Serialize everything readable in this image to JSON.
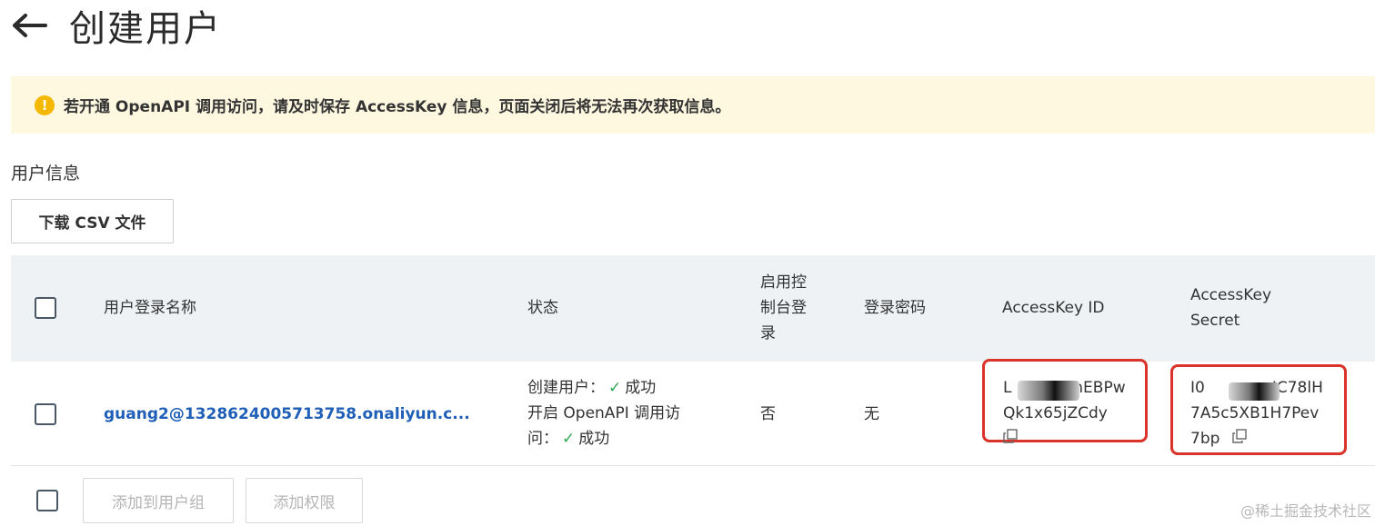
{
  "header": {
    "title": "创建用户",
    "back_icon": "arrow-left-icon"
  },
  "alert": {
    "icon": "warning-icon",
    "icon_glyph": "!",
    "text": "若开通 OpenAPI 调用访问，请及时保存 AccessKey 信息，页面关闭后将无法再次获取信息。",
    "background": "#fff8e1",
    "icon_color": "#f5b800"
  },
  "section": {
    "title": "用户信息"
  },
  "toolbar": {
    "download_label": "下载 CSV 文件"
  },
  "table": {
    "headers": {
      "login_name": "用户登录名称",
      "status": "状态",
      "console_login": [
        "启用控",
        "制台登",
        "录"
      ],
      "password": "登录密码",
      "access_key_id": "AccessKey ID",
      "access_key_secret": [
        "AccessKey",
        "Secret"
      ]
    },
    "rows": [
      {
        "login_name": "guang2@1328624005713758.onaliyun.c...",
        "status_create_label": "创建用户：",
        "status_create_value": "成功",
        "status_openapi_line1": "开启 OpenAPI 调用访",
        "status_openapi_line2": "问：",
        "status_openapi_value": "成功",
        "console_login": "否",
        "password": "无",
        "access_key_id_line1": "L",
        "access_key_id_line1_tail": "mEBPw",
        "access_key_id_line2": "Qk1x65jZCdy",
        "access_key_secret_line1": "I0",
        "access_key_secret_line1_tail": "IC78lH",
        "access_key_secret_line2": "7A5c5XB1H7Pev",
        "access_key_secret_line3": "7bp"
      }
    ]
  },
  "footer": {
    "add_to_group_label": "添加到用户组",
    "add_permission_label": "添加权限"
  },
  "watermark": "@稀土掘金技术社区",
  "colors": {
    "link": "#1f5fb8",
    "success": "#2fa84f",
    "highlight_border": "#d9332a"
  }
}
